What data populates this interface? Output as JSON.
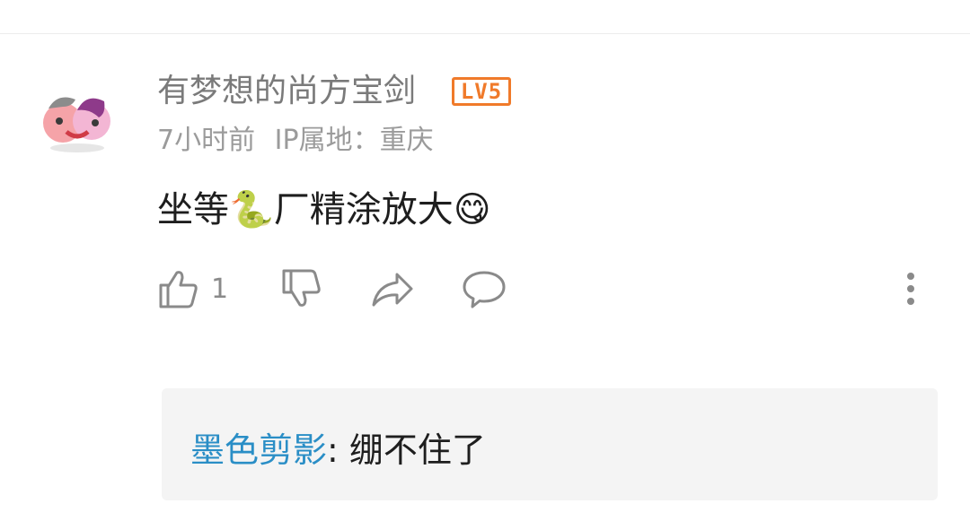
{
  "comment": {
    "username": "有梦想的尚方宝剑",
    "level_badge": "LV5",
    "time": "7小时前",
    "ip_location": "IP属地：重庆",
    "text_before": "坐等",
    "text_after": "厂精涂放大",
    "emoji_snake": "🐍",
    "emoji_face": "😋",
    "actions": {
      "like_icon": "thumbs-up-icon",
      "like_count": "1",
      "dislike_icon": "thumbs-down-icon",
      "share_icon": "share-icon",
      "reply_icon": "comment-bubble-icon",
      "more_icon": "more-vertical-icon"
    }
  },
  "reply_preview": {
    "user": "墨色剪影",
    "separator": ": ",
    "text": "绷不住了"
  },
  "colors": {
    "username": "#7a7a7a",
    "level_badge": "#f07a2a",
    "reply_user": "#2a8ec6",
    "reply_bg": "#f4f4f4"
  }
}
